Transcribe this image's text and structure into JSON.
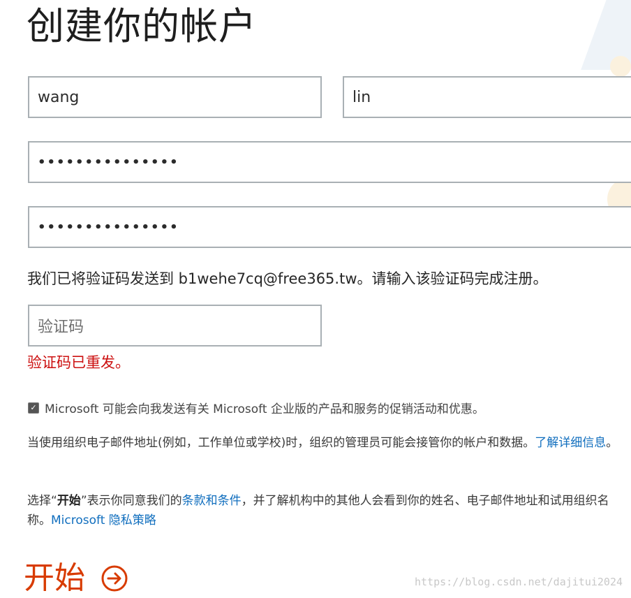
{
  "page": {
    "title": "创建你的帐户"
  },
  "form": {
    "first_name_value": "wang",
    "last_name_value": "lin",
    "password_mask": "•••••••••••••••",
    "confirm_password_mask": "•••••••••••••••",
    "verification_sent_message": "我们已将验证码发送到 b1wehe7cq@free365.tw。请输入该验证码完成注册。",
    "code_placeholder": "验证码",
    "code_resent_message": "验证码已重发。"
  },
  "consent": {
    "checked": true,
    "label": "Microsoft 可能会向我发送有关 Microsoft 企业版的产品和服务的促销活动和优惠。"
  },
  "admin_notice": {
    "text": "当使用组织电子邮件地址(例如，工作单位或学校)时，组织的管理员可能会接管你的帐户和数据。",
    "link": "了解详细信息",
    "end": "。"
  },
  "terms_notice": {
    "prefix": "选择“",
    "bold": "开始",
    "middle": "”表示你同意我们的",
    "terms_link": "条款和条件",
    "rest": "，并了解机构中的其他人会看到你的姓名、电子邮件地址和试用组织名称。",
    "privacy_link": "Microsoft 隐私策略"
  },
  "actions": {
    "start_label": "开始"
  },
  "watermark": "https://blog.csdn.net/dajitui2024",
  "colors": {
    "accent_orange": "#d83b01",
    "link_blue": "#106ebe",
    "error_red": "#cc1010"
  }
}
